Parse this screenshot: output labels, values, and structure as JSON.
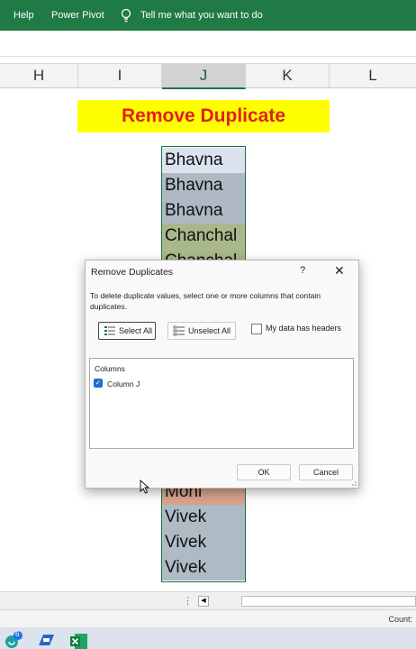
{
  "ribbon": {
    "tabs": [
      "Help",
      "Power Pivot"
    ],
    "tell_me": "Tell me what you want to do"
  },
  "columns": [
    "H",
    "I",
    "J",
    "K",
    "L"
  ],
  "selected_column": "J",
  "title_banner": "Remove Duplicate",
  "cells_top": [
    {
      "text": "Bhavna",
      "bg": "#dce3ef"
    },
    {
      "text": "Bhavna",
      "bg": "#aeb9c4"
    },
    {
      "text": "Bhavna",
      "bg": "#aeb9c4"
    },
    {
      "text": "Chanchal",
      "bg": "#a9b88a"
    },
    {
      "text": "Chanchal",
      "bg": "#a9b88a"
    }
  ],
  "cells_bottom": [
    {
      "text": "Moni",
      "bg": "#d9a38b"
    },
    {
      "text": "Vivek",
      "bg": "#aebbc5"
    },
    {
      "text": "Vivek",
      "bg": "#aebbc5"
    },
    {
      "text": "Vivek",
      "bg": "#aebbc5"
    }
  ],
  "dialog": {
    "title": "Remove Duplicates",
    "help": "?",
    "close": "✕",
    "description": "To delete duplicate values, select one or more columns that contain duplicates.",
    "select_all": "Select All",
    "unselect_all": "Unselect All",
    "has_headers": "My data has headers",
    "list_header": "Columns",
    "column_item": "Column J",
    "ok": "OK",
    "cancel": "Cancel"
  },
  "statusbar": {
    "text": "Count:"
  },
  "taskbar": {
    "badge": "6"
  },
  "colors": {
    "ribbon": "#1f7a45",
    "title_bg": "#ffff00",
    "title_fg": "#e02020",
    "selection_border": "#1e7145",
    "checkbox": "#1a6fd1"
  }
}
